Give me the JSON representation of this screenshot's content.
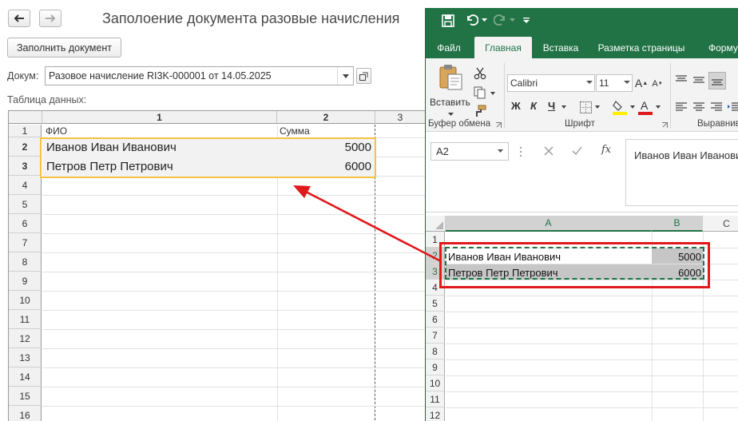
{
  "onec": {
    "back_icon": "arrow-left-icon",
    "forward_icon": "arrow-right-icon",
    "title": "Заполоение документа разовые начисления",
    "fill_button": "Заполнить документ",
    "doc_label": "Докум:",
    "doc_value": "Разовое начисление RI3K-000001 от 14.05.2025",
    "table_label": "Таблица данных:",
    "columns": [
      "1",
      "2",
      "3"
    ],
    "rows": [
      "1",
      "2",
      "3",
      "4",
      "5",
      "6",
      "7",
      "8",
      "9",
      "10",
      "11",
      "12",
      "13",
      "14",
      "15",
      "16"
    ],
    "header_row": {
      "fio": "ФИО",
      "sum": "Сумма"
    },
    "data": [
      {
        "fio": "Иванов Иван Иванович",
        "sum": "5000"
      },
      {
        "fio": "Петров Петр Петрович",
        "sum": "6000"
      }
    ],
    "selection_color": "#f5c242"
  },
  "excel": {
    "accent": "#217346",
    "tabs": [
      "Файл",
      "Главная",
      "Вставка",
      "Разметка страницы",
      "Форму"
    ],
    "active_tab": "Главная",
    "paste_label": "Вставить",
    "clipboard_group": "Буфер обмена",
    "font_group": "Шрифт",
    "align_group": "Выравнив",
    "font_name": "Calibri",
    "font_size": "11",
    "bold": "Ж",
    "italic": "К",
    "underline": "Ч",
    "name_box": "A2",
    "fx": "fx",
    "formula_value": "Иванов Иван Иванович",
    "columns": [
      "A",
      "B",
      "C"
    ],
    "rows": [
      "1",
      "2",
      "3",
      "4",
      "5",
      "6",
      "7",
      "8",
      "9",
      "10",
      "11",
      "12"
    ],
    "data": [
      {
        "a": "Иванов Иван Иванович",
        "b": "5000"
      },
      {
        "a": "Петров Петр Петрович",
        "b": "6000"
      }
    ],
    "highlight_color": "#e0191d"
  }
}
